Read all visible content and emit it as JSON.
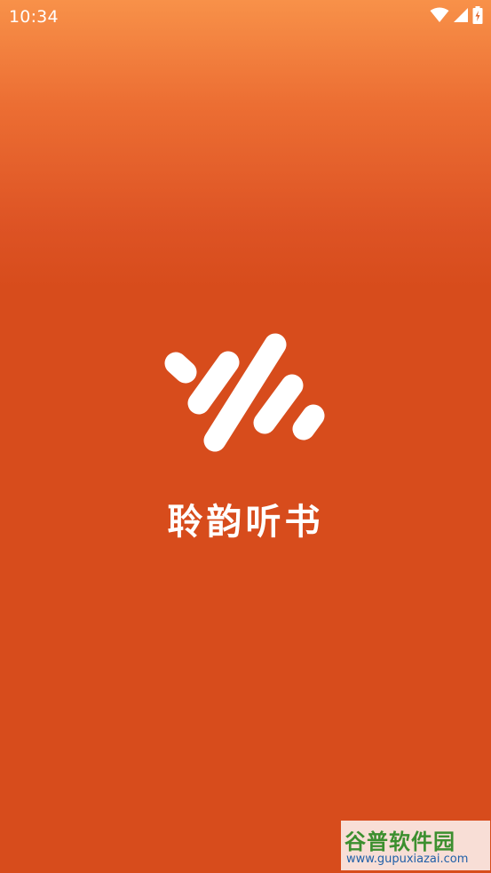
{
  "status_bar": {
    "time": "10:34",
    "icons": [
      "wifi-icon",
      "signal-icon",
      "battery-charging-icon"
    ]
  },
  "splash": {
    "logo_icon": "sound-wave-logo-icon",
    "app_name": "聆韵听书"
  },
  "watermark": {
    "title": "谷普软件园",
    "url": "www.gupuxiazai.com"
  },
  "colors": {
    "background_top": "#f89149",
    "background_main": "#d74c1c",
    "logo": "#ffffff"
  }
}
